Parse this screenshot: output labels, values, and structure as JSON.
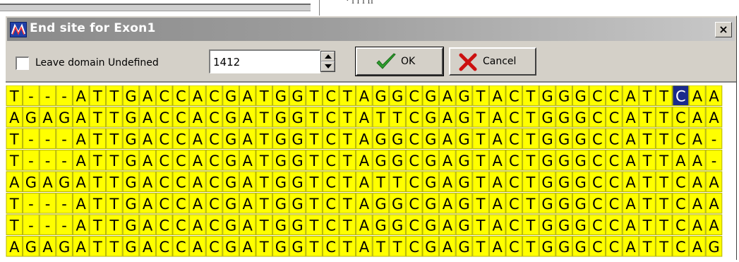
{
  "background": {
    "partial_text": "· ı ı ı fl"
  },
  "dialog": {
    "title": "End site for Exon1",
    "close_label": "×"
  },
  "toolbar": {
    "checkbox_label": "Leave domain Undefined",
    "checkbox_checked": false,
    "position_value": "1412",
    "ok_label": "OK",
    "cancel_label": "Cancel"
  },
  "colors": {
    "cell_fill": "#ffff00",
    "cell_border": "#b4b400",
    "selected_fill": "#1a2a8c",
    "selected_text": "#ffffff",
    "ok_check": "#2ea02e",
    "cancel_x": "#cc1010"
  },
  "alignment": {
    "selected": {
      "row": 0,
      "col": 40
    },
    "rows": [
      "T---ATTGACCACGATGGTCTAGGCGAGTACTGGGCCATTCAA",
      "AGAGATTGACCACGATGGTCTATTCGAGTACTGGGCCATTCAA",
      "T---ATTGACCACGATGGTCTAGGCGAGTACTGGGCCATTCA-",
      "T---ATTGACCACGATGGTCTAGGCGAGTACTGGGCCATTAA-",
      "AGAGATTGACCACGATGGTCTATTCGAGTACTGGGCCATTCAA",
      "T---ATTGACCACGATGGTCTAGGCGAGTACTGGGCCATTCAA",
      "T---ATTGACCACGATGGTCTAGGCGAGTACTGGGCCATTCAA",
      "AGAGATTGACCACGATGGTCTATTCGAGTACTGGGCCATTCAG"
    ]
  }
}
